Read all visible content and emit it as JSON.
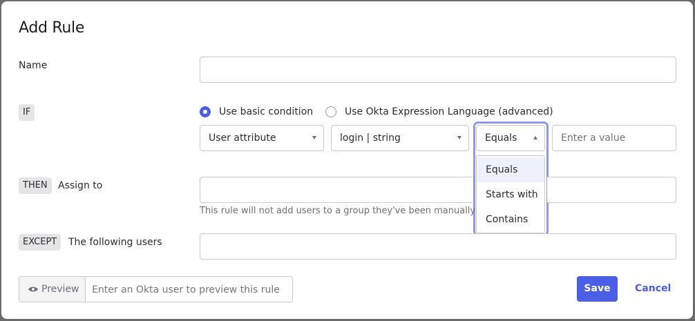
{
  "dialog": {
    "title": "Add Rule",
    "name_label": "Name",
    "name_value": "",
    "if_tag": "IF",
    "condition_mode": {
      "basic_label": "Use basic condition",
      "advanced_label": "Use Okta Expression Language (advanced)",
      "selected": "basic"
    },
    "condition": {
      "attribute_type": "User attribute",
      "attribute": "login | string",
      "operator": "Equals",
      "value_placeholder": "Enter a value",
      "operator_options": [
        "Equals",
        "Starts with",
        "Contains"
      ],
      "highlighted_option": "Equals"
    },
    "then_tag": "THEN",
    "assign_label": "Assign to",
    "assign_helper": "This rule will not add users to a group they've been manually",
    "except_tag": "EXCEPT",
    "except_label": "The following users",
    "preview": {
      "button_label": "Preview",
      "input_placeholder": "Enter an Okta user to preview this rule"
    },
    "actions": {
      "save_label": "Save",
      "cancel_label": "Cancel"
    }
  },
  "colors": {
    "accent": "#4a5ee6",
    "focus_ring": "#8e96f0",
    "tag_bg": "#e5e5e7"
  },
  "icons": {
    "preview": "eye-icon",
    "select_caret": "chevron-down-icon"
  }
}
